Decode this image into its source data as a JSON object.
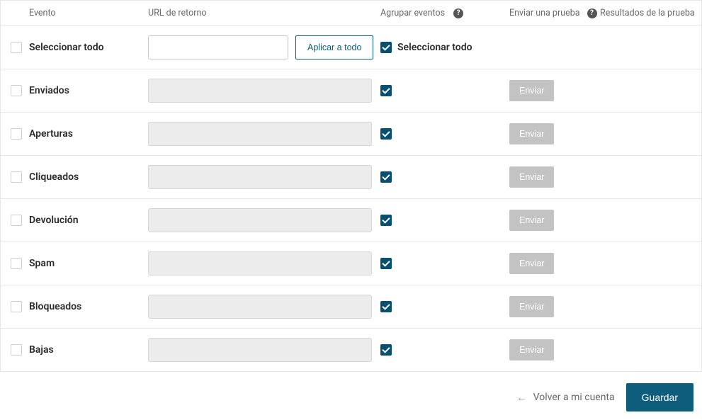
{
  "headers": {
    "event": "Evento",
    "url": "URL de retorno",
    "group": "Agrupar eventos",
    "send": "Enviar una prueba",
    "results": "Resultados de la prueba"
  },
  "selectAll": {
    "eventLabel": "Seleccionar todo",
    "applyLabel": "Aplicar a todo",
    "groupLabel": "Seleccionar todo"
  },
  "sendButtonLabel": "Enviar",
  "rows": [
    {
      "label": "Enviados"
    },
    {
      "label": "Aperturas"
    },
    {
      "label": "Cliqueados"
    },
    {
      "label": "Devolución"
    },
    {
      "label": "Spam"
    },
    {
      "label": "Bloqueados"
    },
    {
      "label": "Bajas"
    }
  ],
  "footer": {
    "back": "Volver a mi cuenta",
    "save": "Guardar"
  }
}
